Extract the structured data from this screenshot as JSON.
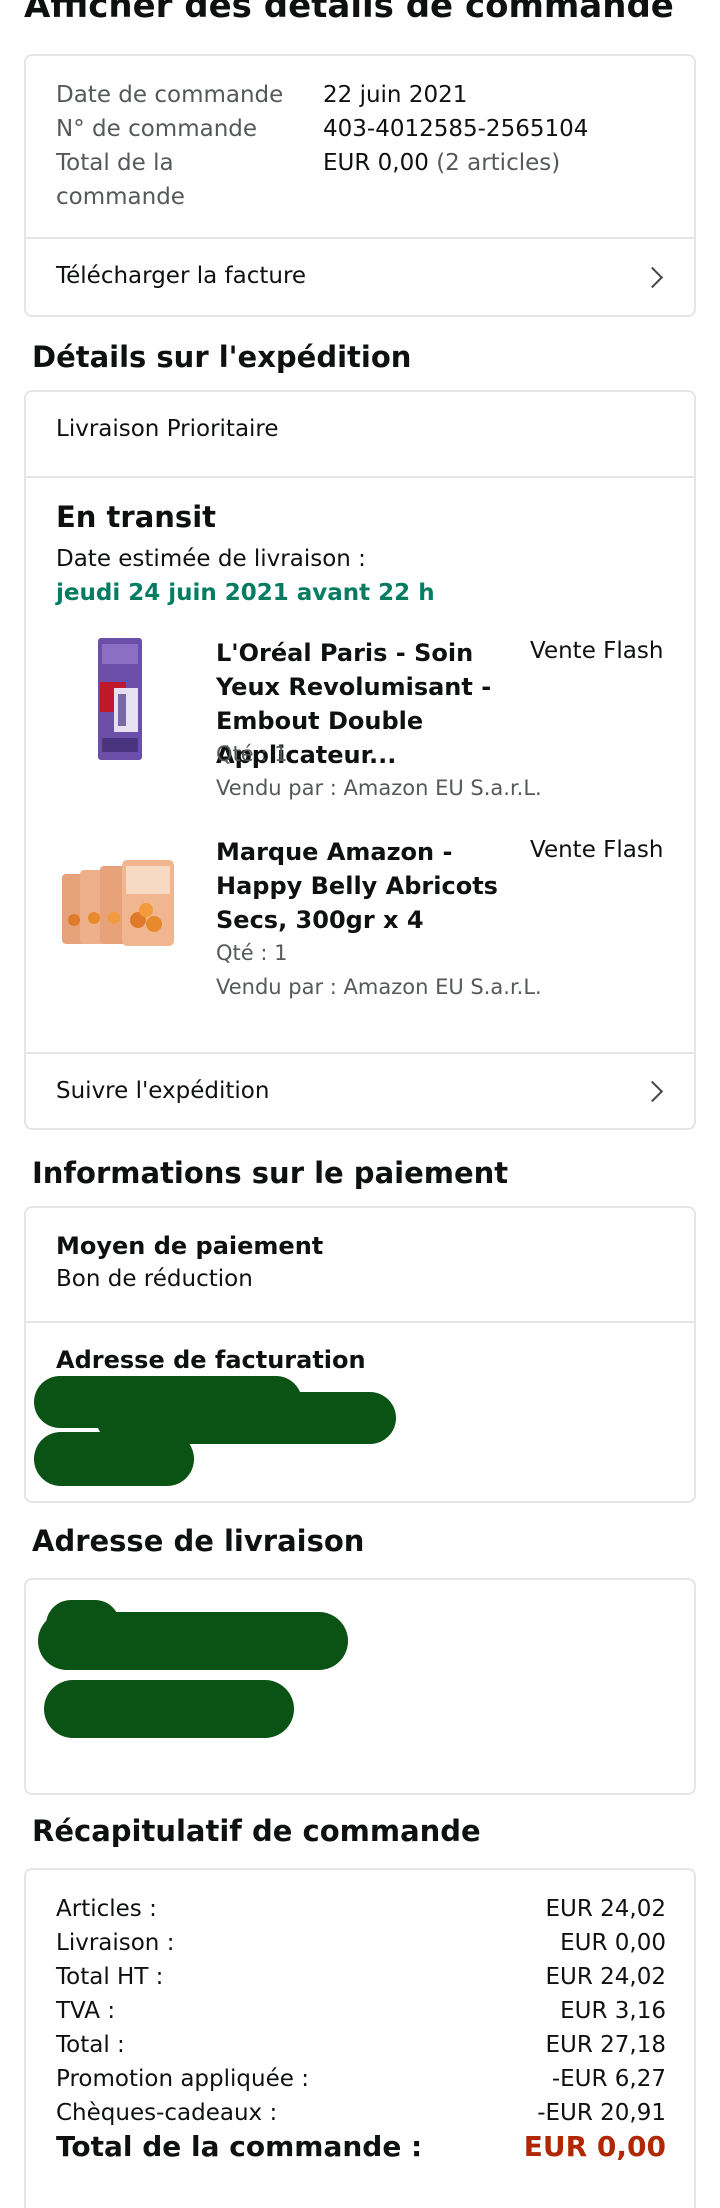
{
  "page_title": "Afficher des détails de commande",
  "order": {
    "date_label": "Date de commande",
    "date_value": "22 juin 2021",
    "number_label": "N° de commande",
    "number_value": "403-4012585-2565104",
    "total_label_line1": "Total de la",
    "total_label_line2": "commande",
    "total_amount": "EUR 0,00",
    "total_items": "(2 articles)",
    "invoice_label": "Télécharger la facture"
  },
  "shipping": {
    "heading": "Détails sur l'expédition",
    "method": "Livraison Prioritaire",
    "status": "En transit",
    "eta_label": "Date estimée de livraison :",
    "eta_value": "jeudi 24 juin 2021 avant 22 h",
    "items": [
      {
        "title": "L'Oréal Paris - Soin Yeux Revolumisant - Embout Double Applicateur...",
        "tag": "Vente Flash",
        "qty": "Qté : 1",
        "seller": "Vendu par : Amazon EU S.a.r.L."
      },
      {
        "title": "Marque Amazon - Happy Belly Abricots Secs, 300gr x 4",
        "tag": "Vente Flash",
        "qty": "Qté : 1",
        "seller": "Vendu par : Amazon EU S.a.r.L."
      }
    ],
    "track_label": "Suivre l'expédition"
  },
  "payment": {
    "heading": "Informations sur le paiement",
    "method_label": "Moyen de paiement",
    "method_value": "Bon de réduction",
    "billing_label": "Adresse de facturation"
  },
  "delivery": {
    "heading": "Adresse de livraison"
  },
  "summary": {
    "heading": "Récapitulatif de commande",
    "rows": [
      {
        "label": "Articles :",
        "value": "EUR 24,02"
      },
      {
        "label": "Livraison :",
        "value": "EUR 0,00"
      },
      {
        "label": "Total HT :",
        "value": "EUR 24,02"
      },
      {
        "label": "TVA :",
        "value": "EUR 3,16"
      },
      {
        "label": "Total :",
        "value": "EUR 27,18"
      },
      {
        "label": "Promotion appliquée :",
        "value": "-EUR 6,27"
      },
      {
        "label": "Chèques-cadeaux :",
        "value": "-EUR 20,91"
      }
    ],
    "grand_total_label": "Total de la commande :",
    "grand_total_value": "EUR 0,00"
  },
  "colors": {
    "eta_green": "#067d62",
    "total_red": "#b12704",
    "redaction": "#0b5314",
    "border": "#e4e6e6"
  }
}
